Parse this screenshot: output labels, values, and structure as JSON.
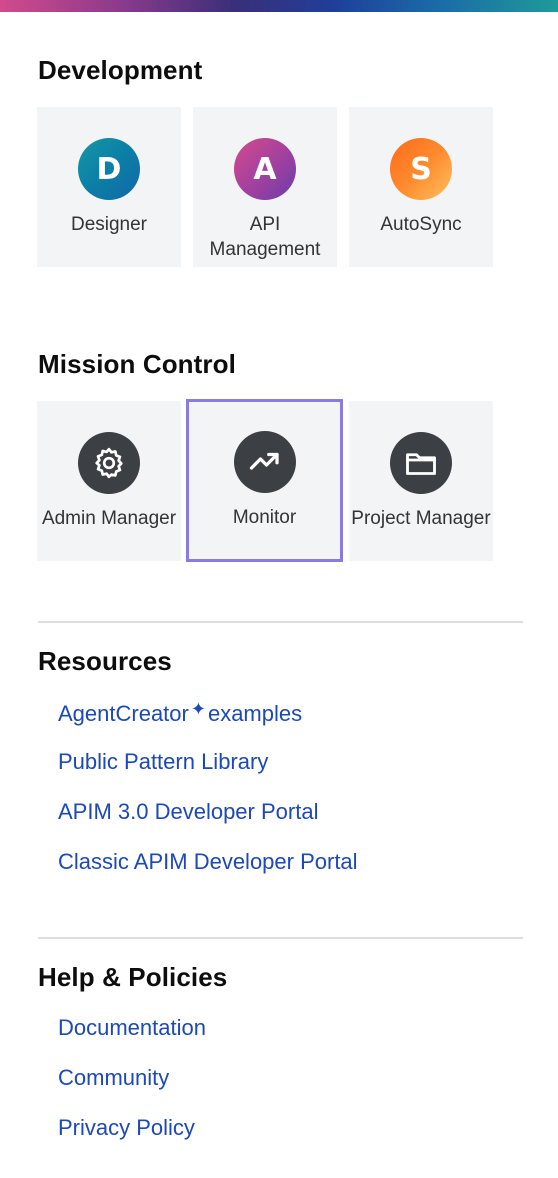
{
  "sections": {
    "development": {
      "title": "Development",
      "tiles": [
        {
          "letter": "D",
          "label": "Designer",
          "icon": "letter-d-icon"
        },
        {
          "letter": "A",
          "label": "API Management",
          "icon": "letter-a-icon"
        },
        {
          "letter": "S",
          "label": "AutoSync",
          "icon": "letter-s-icon"
        }
      ]
    },
    "mission_control": {
      "title": "Mission Control",
      "tiles": [
        {
          "label": "Admin Manager",
          "icon": "gear-icon"
        },
        {
          "label": "Monitor",
          "icon": "trend-up-icon",
          "selected": true
        },
        {
          "label": "Project Manager",
          "icon": "folder-icon"
        }
      ]
    },
    "resources": {
      "title": "Resources",
      "links": {
        "agentcreator_part1": "AgentCreator",
        "agentcreator_part2": "examples",
        "public_pattern_library": "Public Pattern Library",
        "apim3_portal": "APIM 3.0 Developer Portal",
        "classic_apim_portal": "Classic APIM Developer Portal"
      }
    },
    "help": {
      "title": "Help & Policies",
      "links": {
        "documentation": "Documentation",
        "community": "Community",
        "privacy_policy": "Privacy Policy"
      }
    }
  },
  "colors": {
    "link": "#1d48b8",
    "selected_outline": "#8b7be0",
    "tile_bg": "#f3f4f6",
    "dark_icon": "#3c3f44"
  }
}
